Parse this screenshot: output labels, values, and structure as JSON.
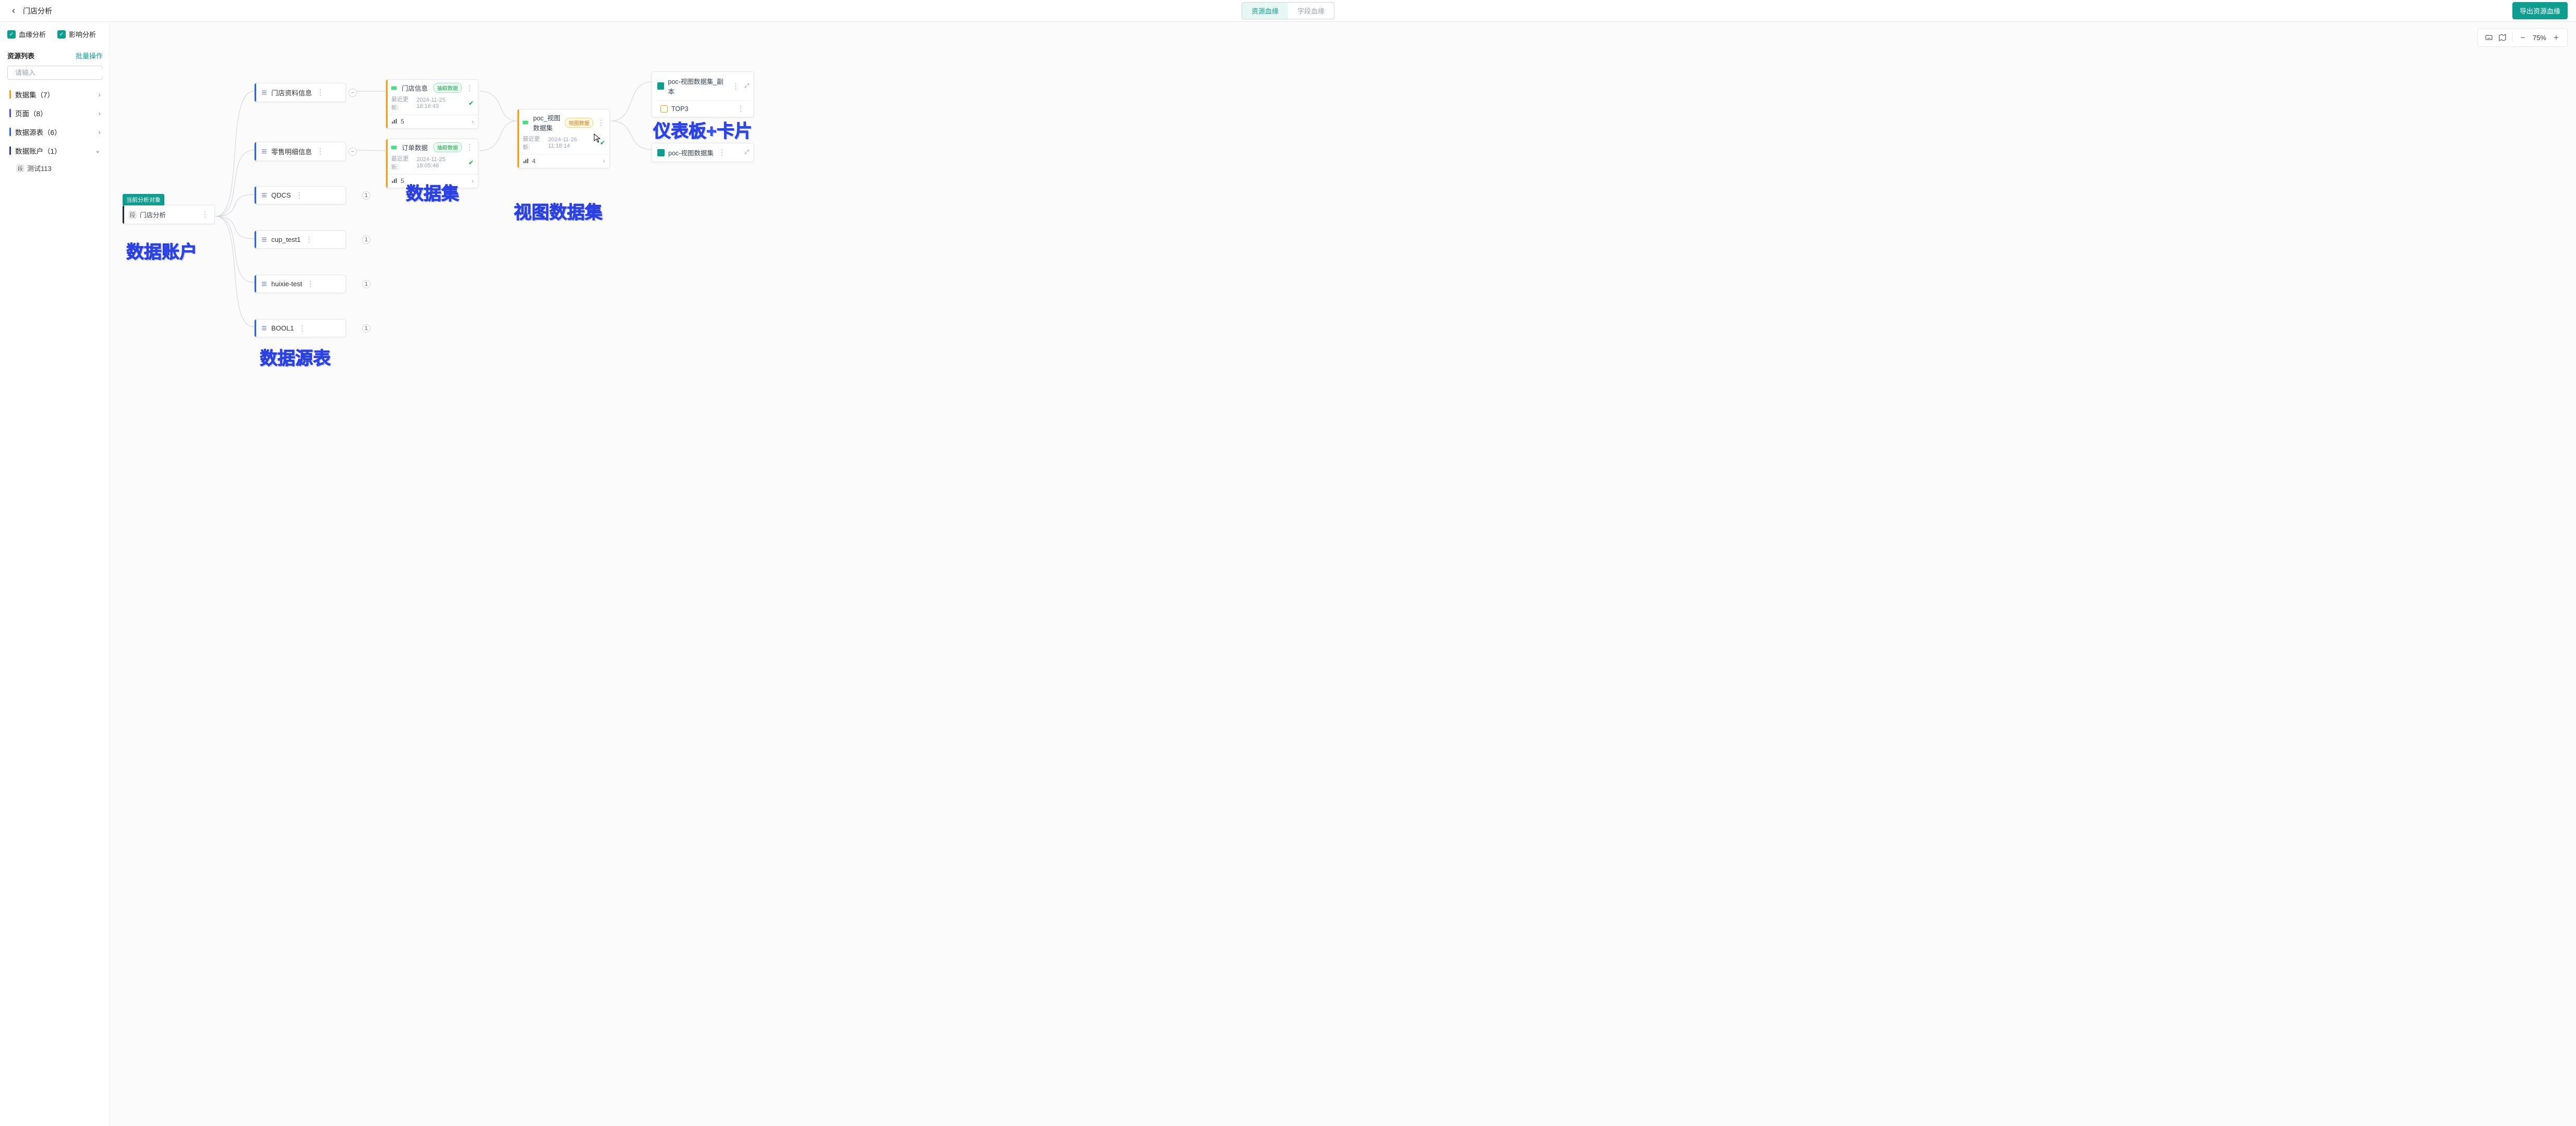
{
  "header": {
    "title": "门店分析",
    "tab_lineage": "资源血缘",
    "tab_field": "字段血缘",
    "export_label": "导出资源血缘"
  },
  "sidebar": {
    "check_lineage": "血缘分析",
    "check_impact": "影响分析",
    "list_title": "资源列表",
    "bulk_label": "批量操作",
    "search_placeholder": "请输入",
    "items": [
      {
        "label": "数据集（7）",
        "bar": "orange",
        "expanded": false
      },
      {
        "label": "页面（8）",
        "bar": "blue1",
        "expanded": false
      },
      {
        "label": "数据源表（6）",
        "bar": "blue2",
        "expanded": false
      },
      {
        "label": "数据账户（1）",
        "bar": "blue3",
        "expanded": true
      }
    ],
    "sub_item": {
      "icon": "段",
      "label": "测试113"
    }
  },
  "toolbar": {
    "zoom_label": "75%"
  },
  "root_node": {
    "tag": "当前分析对象",
    "icon": "段",
    "name": "门店分析"
  },
  "table_nodes": [
    {
      "name": "门店资料信息",
      "right": "minus",
      "num": null
    },
    {
      "name": "零售明细信息",
      "right": "minus",
      "num": null
    },
    {
      "name": "QDCS",
      "right": "num",
      "num": "1"
    },
    {
      "name": "cup_test1",
      "right": "num",
      "num": "1"
    },
    {
      "name": "huixie-test",
      "right": "num",
      "num": "1"
    },
    {
      "name": "BOOL1",
      "right": "num",
      "num": "1"
    }
  ],
  "dataset_nodes": [
    {
      "name": "门店信息",
      "pill": "抽取数据",
      "pill_cls": "pill-green",
      "updated_label": "最近更新:",
      "updated": "2024-11-25 18:16:43",
      "count": "5"
    },
    {
      "name": "订单数据",
      "pill": "抽取数据",
      "pill_cls": "pill-green",
      "updated_label": "最近更新:",
      "updated": "2024-11-25 18:05:46",
      "count": "5"
    }
  ],
  "view_dataset": {
    "name": "poc_视图数据集",
    "pill": "视图数据",
    "pill_cls": "pill-amber",
    "updated_label": "最近更新:",
    "updated": "2024-11-26 11:18:14",
    "count": "4"
  },
  "dash_nodes": [
    {
      "name": "poc-视图数据集_副本",
      "card": "TOP3"
    },
    {
      "name": "poc-视图数据集",
      "card": null
    }
  ],
  "big_labels": {
    "account": "数据账户",
    "sourcetable": "数据源表",
    "dataset": "数据集",
    "viewdataset": "视图数据集",
    "dashcard": "仪表板+卡片"
  }
}
